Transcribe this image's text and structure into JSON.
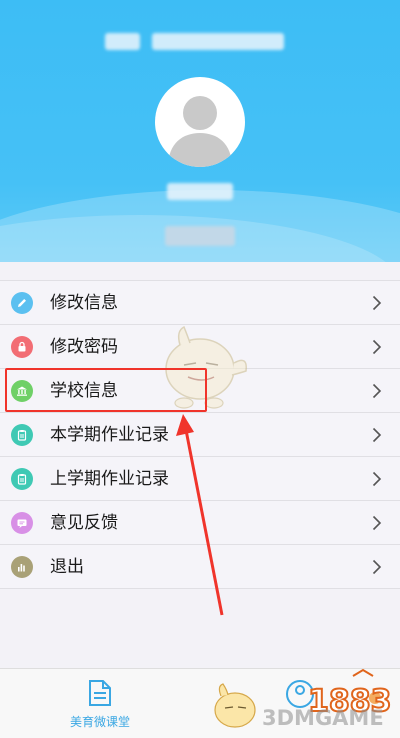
{
  "header": {
    "background": "#46c1f6"
  },
  "menu": {
    "items": [
      {
        "label": "修改信息",
        "icon": "pencil-icon",
        "color": "#5bc0f0"
      },
      {
        "label": "修改密码",
        "icon": "lock-icon",
        "color": "#f26d74"
      },
      {
        "label": "学校信息",
        "icon": "school-icon",
        "color": "#6fd067"
      },
      {
        "label": "本学期作业记录",
        "icon": "clipboard-icon",
        "color": "#3fc9b4"
      },
      {
        "label": "上学期作业记录",
        "icon": "clipboard-icon",
        "color": "#3fc9b4"
      },
      {
        "label": "意见反馈",
        "icon": "message-icon",
        "color": "#d890e6"
      },
      {
        "label": "退出",
        "icon": "bar-chart-icon",
        "color": "#a9a177"
      }
    ]
  },
  "tabbar": {
    "tabs": [
      {
        "label": "美育微课堂",
        "icon": "document-icon"
      }
    ]
  },
  "watermark": {
    "brand": "3DMGAME",
    "number": "1883"
  },
  "annotation": {
    "highlight_color": "#f0342b"
  }
}
